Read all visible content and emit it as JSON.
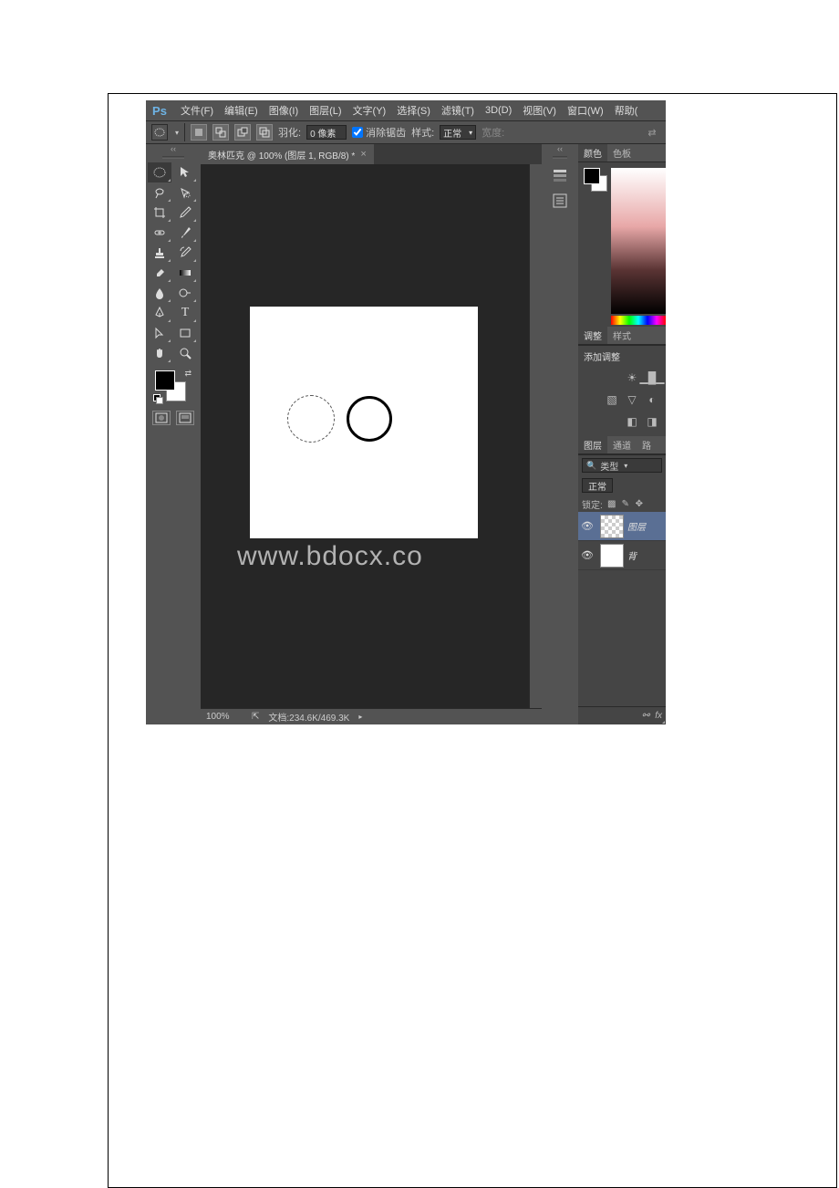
{
  "logo": "Ps",
  "menu": {
    "file": "文件(F)",
    "edit": "编辑(E)",
    "image": "图像(I)",
    "layer": "图层(L)",
    "type": "文字(Y)",
    "select": "选择(S)",
    "filter": "滤镜(T)",
    "threeD": "3D(D)",
    "view": "视图(V)",
    "window": "窗口(W)",
    "help": "帮助("
  },
  "options": {
    "feather_label": "羽化:",
    "feather_value": "0 像素",
    "antialias": "消除锯齿",
    "style_label": "样式:",
    "style_value": "正常",
    "width_label": "宽度:"
  },
  "doc": {
    "tab_title": "奥林匹克 @ 100% (图层 1, RGB/8) *"
  },
  "status": {
    "zoom": "100%",
    "docinfo": "文档:234.6K/469.3K"
  },
  "panels": {
    "color_tab": "颜色",
    "swatches_tab": "色板",
    "adjust_tab": "调整",
    "styles_tab": "样式",
    "add_adjust": "添加调整",
    "layers_tab": "图层",
    "channels_tab": "通道",
    "paths_tab": "路",
    "filter_kind": "类型",
    "blend_mode": "正常",
    "lock_label": "锁定:",
    "layer1": "图层",
    "background": "背",
    "footer_fx": "fx"
  },
  "watermark": "www.bdocx.co"
}
